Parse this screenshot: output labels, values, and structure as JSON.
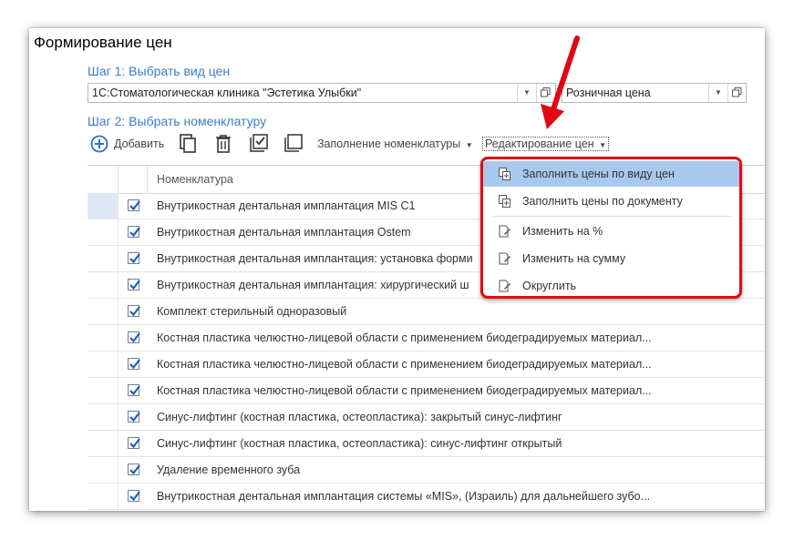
{
  "window": {
    "title": "Формирование цен"
  },
  "step1": {
    "label": "Шаг 1: Выбрать вид цен",
    "organization_value": "1С:Стоматологическая клиника \"Эстетика Улыбки\"",
    "price_type_value": "Розничная цена"
  },
  "step2": {
    "label": "Шаг 2: Выбрать номенклатуру"
  },
  "toolbar": {
    "add_label": "Добавить",
    "fill_label": "Заполнение номенклатуры",
    "edit_prices_label": "Редактирование цен",
    "icons": [
      "plus-circle-icon",
      "copy-icon",
      "trash-icon",
      "check-all-icon",
      "uncheck-all-icon"
    ]
  },
  "table": {
    "column_header": "Номенклатура",
    "rows": [
      {
        "name": "Внутрикостная дентальная имплантация MIS C1",
        "checked": true
      },
      {
        "name": "Внутрикостная дентальная имплантация Ostem",
        "checked": true
      },
      {
        "name": "Внутрикостная дентальная имплантация: установка форми",
        "checked": true
      },
      {
        "name": "Внутрикостная дентальная имплантация: хирургический ш",
        "checked": true
      },
      {
        "name": "Комплект стерильный одноразовый",
        "checked": true
      },
      {
        "name": "Костная пластика челюстно-лицевой области с применением биодеградируемых материал...",
        "checked": true
      },
      {
        "name": "Костная пластика челюстно-лицевой области с применением биодеградируемых материал...",
        "checked": true
      },
      {
        "name": "Костная пластика челюстно-лицевой области с применением биодеградируемых материал...",
        "checked": true
      },
      {
        "name": "Синус-лифтинг (костная пластика, остеопластика): закрытый синус-лифтинг",
        "checked": true
      },
      {
        "name": "Синус-лифтинг (костная пластика, остеопластика): синус-лифтинг открытый",
        "checked": true
      },
      {
        "name": "Удаление временного зуба",
        "checked": true
      },
      {
        "name": "Внутрикостная дентальная имплантация системы «MIS», (Израиль) для дальнейшего зубо...",
        "checked": true
      }
    ]
  },
  "dropdown_menu": {
    "items": [
      {
        "label": "Заполнить цены по виду цен",
        "icon": "fill-copy-icon"
      },
      {
        "label": "Заполнить цены по документу",
        "icon": "fill-copy-icon"
      },
      {
        "label": "Изменить на %",
        "icon": "edit-doc-icon"
      },
      {
        "label": "Изменить на сумму",
        "icon": "edit-doc-icon"
      },
      {
        "label": "Округлить",
        "icon": "edit-doc-icon"
      }
    ]
  },
  "colors": {
    "accent": "#3a7dc9",
    "highlight": "#a9c8ef",
    "annotation_red": "#e30613"
  }
}
